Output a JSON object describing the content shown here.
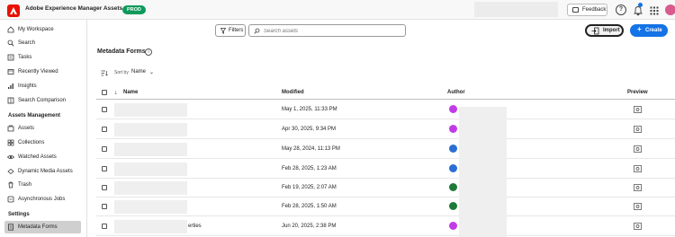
{
  "app": {
    "title": "Adobe Experience Manager Assets",
    "env_badge": "PROD"
  },
  "header": {
    "feedback_label": "Feedback",
    "help_symbol": "?",
    "brand_color": "#eb1000",
    "env_color": "#0d9a5a",
    "accent_color": "#1473e6"
  },
  "sidebar": {
    "items": [
      {
        "label": "My Workspace",
        "icon": "home-icon"
      },
      {
        "label": "Search",
        "icon": "search-icon"
      },
      {
        "label": "Tasks",
        "icon": "tasks-icon"
      },
      {
        "label": "Recently Viewed",
        "icon": "recent-icon"
      },
      {
        "label": "Insights",
        "icon": "chart-icon"
      },
      {
        "label": "Search Comparison",
        "icon": "compare-icon"
      }
    ],
    "section_assets": "Assets Management",
    "assets_items": [
      {
        "label": "Assets",
        "icon": "assets-icon"
      },
      {
        "label": "Collections",
        "icon": "collections-icon"
      },
      {
        "label": "Watched Assets",
        "icon": "eye-icon"
      },
      {
        "label": "Dynamic Media Assets",
        "icon": "dynamic-media-icon"
      },
      {
        "label": "Trash",
        "icon": "trash-icon"
      },
      {
        "label": "Asynchronous Jobs",
        "icon": "jobs-icon"
      }
    ],
    "section_settings": "Settings",
    "settings_items": [
      {
        "label": "Metadata Forms",
        "icon": "forms-icon",
        "selected": true
      }
    ]
  },
  "toolbar": {
    "filters_label": "Filters",
    "search_placeholder": "Search assets",
    "import_label": "Import",
    "create_label": "Create"
  },
  "page": {
    "title": "Metadata Forms",
    "sort_prefix": "Sort by",
    "sort_value": "Name"
  },
  "table": {
    "columns": {
      "name": "Name",
      "modified": "Modified",
      "author": "Author",
      "preview": "Preview"
    },
    "rows": [
      {
        "name_suffix": "",
        "modified": "May 1, 2025, 11:33 PM",
        "avatar_color": "#c13be8"
      },
      {
        "name_suffix": "",
        "modified": "Apr 30, 2025, 9:34 PM",
        "avatar_color": "#c13be8"
      },
      {
        "name_suffix": "",
        "modified": "May 28, 2024, 11:13 PM",
        "avatar_color": "#2a6fd6"
      },
      {
        "name_suffix": "",
        "modified": "Feb 28, 2025, 1:23 AM",
        "avatar_color": "#2a6fd6"
      },
      {
        "name_suffix": "",
        "modified": "Feb 19, 2025, 2:07 AM",
        "avatar_color": "#1f7a3a"
      },
      {
        "name_suffix": "",
        "modified": "Feb 28, 2025, 1:50 AM",
        "avatar_color": "#1f7a3a"
      },
      {
        "name_suffix": "erties",
        "modified": "Jun 20, 2025, 2:38 PM",
        "avatar_color": "#c13be8"
      }
    ]
  }
}
